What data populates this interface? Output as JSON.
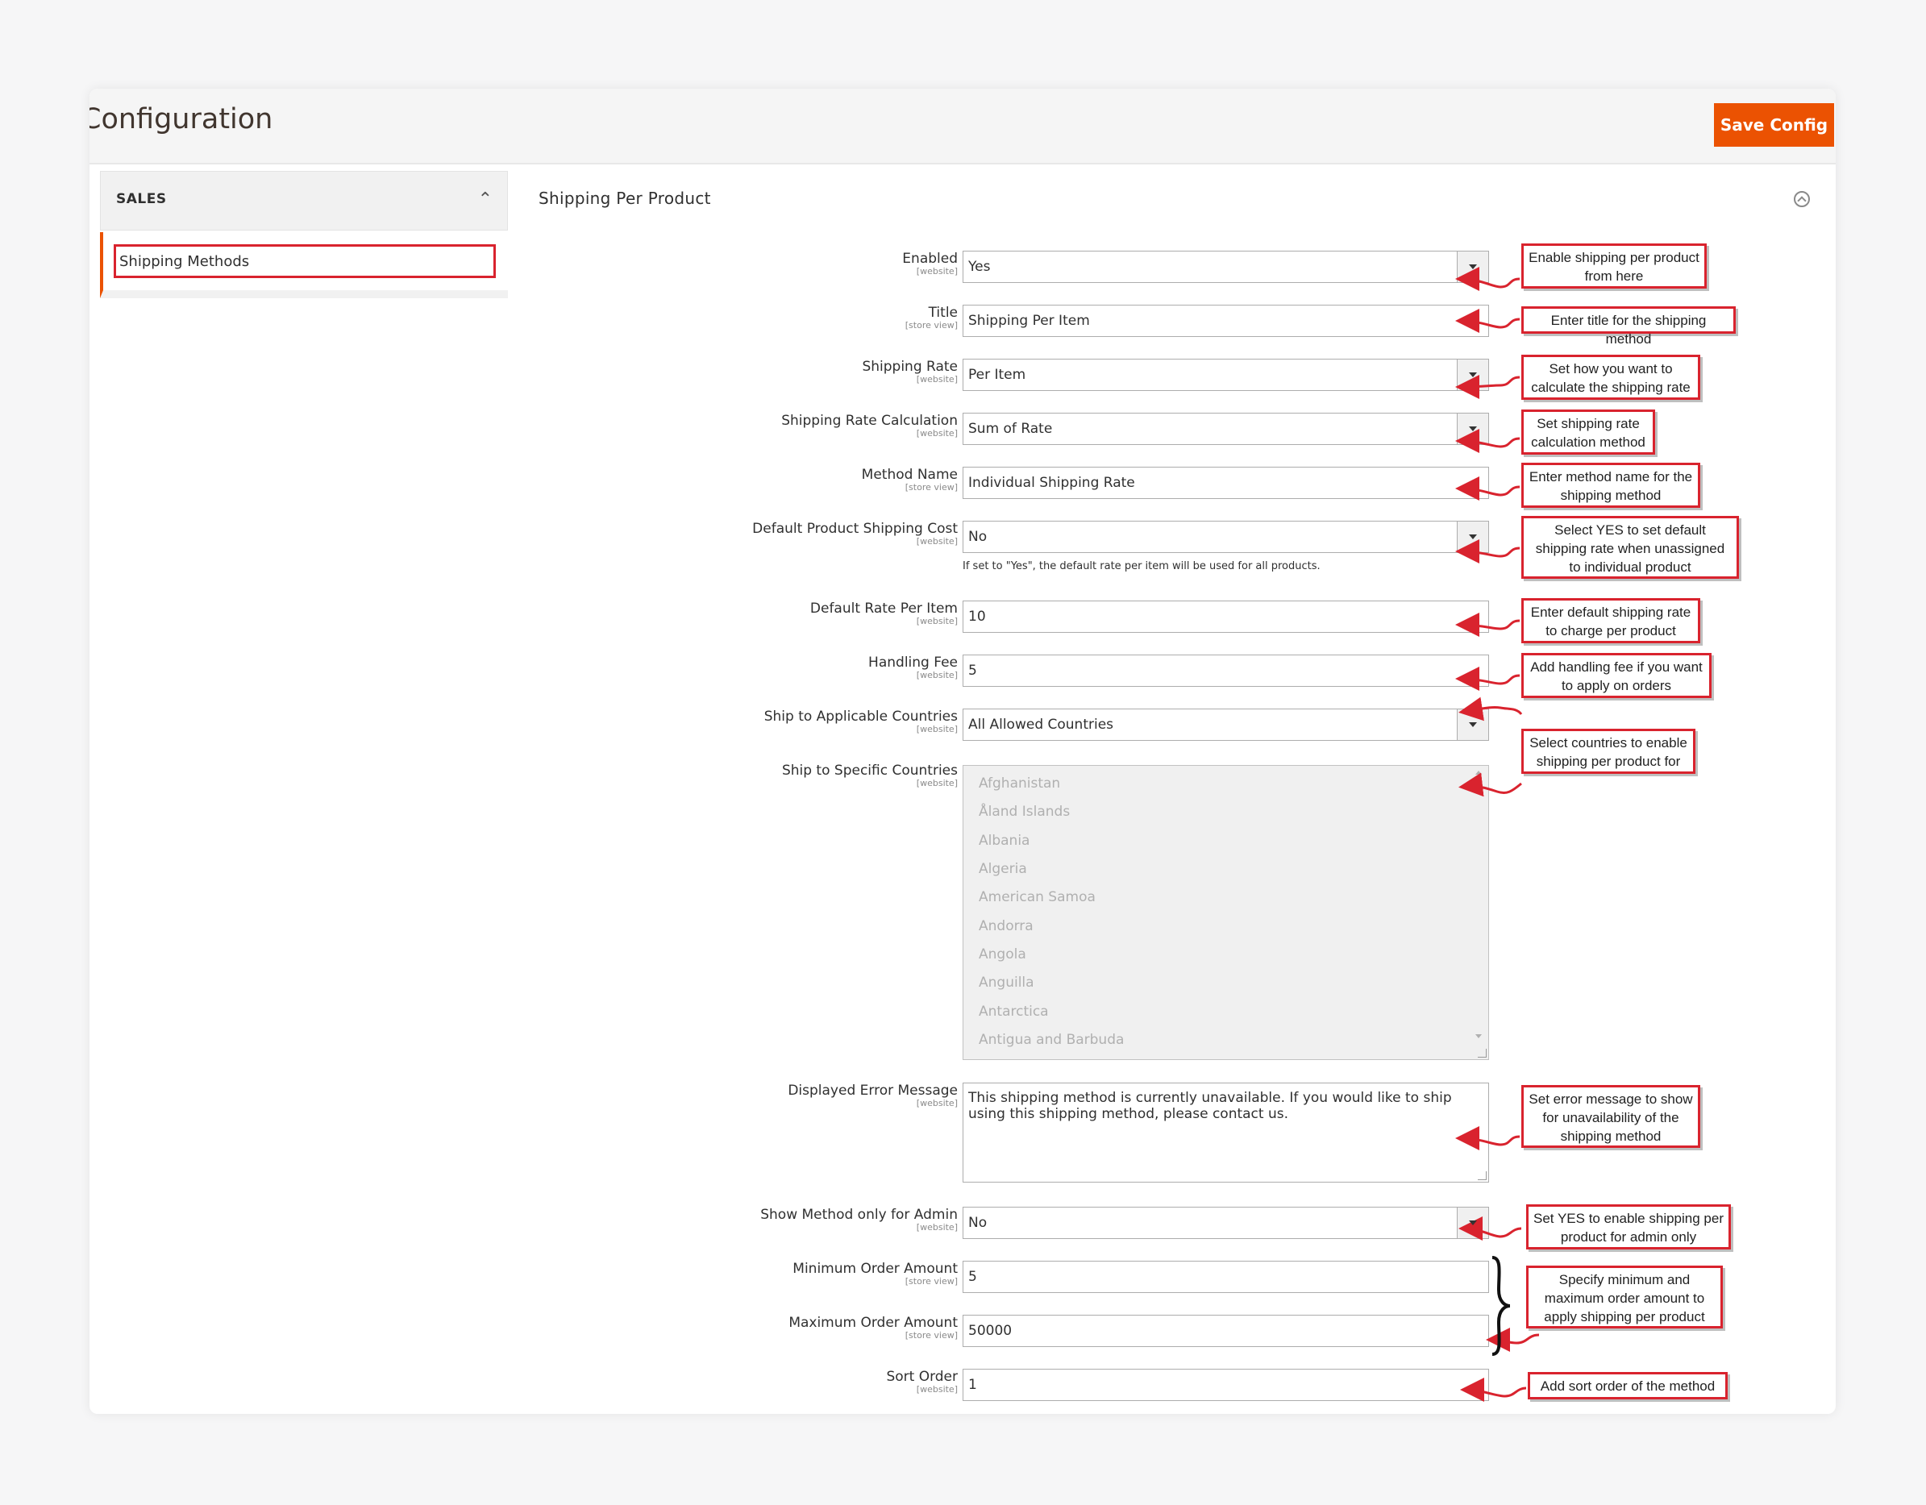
{
  "header": {
    "title": "Configuration",
    "save_label": "Save Config"
  },
  "sidebar": {
    "section_label": "SALES",
    "chevron": "chevron-up-icon",
    "items": [
      {
        "label": "Shipping Methods",
        "active": true
      }
    ]
  },
  "section": {
    "title": "Shipping Per Product",
    "collapse_icon": "collapse-up-circle-icon"
  },
  "fields": [
    {
      "label": "Enabled",
      "scope": "[website]",
      "value": "Yes",
      "kind": "select"
    },
    {
      "label": "Title",
      "scope": "[store view]",
      "value": "Shipping Per Item",
      "kind": "text"
    },
    {
      "label": "Shipping Rate",
      "scope": "[website]",
      "value": "Per Item",
      "kind": "select"
    },
    {
      "label": "Shipping Rate Calculation",
      "scope": "[website]",
      "value": "Sum of Rate",
      "kind": "select"
    },
    {
      "label": "Method Name",
      "scope": "[store view]",
      "value": "Individual Shipping Rate",
      "kind": "text"
    },
    {
      "label": "Default Product Shipping Cost",
      "scope": "[website]",
      "value": "No",
      "kind": "select"
    },
    {
      "label": "Default Rate Per Item",
      "scope": "[website]",
      "value": "10",
      "kind": "text"
    },
    {
      "label": "Handling Fee",
      "scope": "[website]",
      "value": "5",
      "kind": "text"
    },
    {
      "label": "Ship to Applicable Countries",
      "scope": "[website]",
      "value": "All Allowed Countries",
      "kind": "select"
    },
    {
      "label": "Ship to Specific Countries",
      "scope": "[website]",
      "kind": "multiselect"
    },
    {
      "label": "Displayed Error Message",
      "scope": "[website]",
      "value": "This shipping method is currently unavailable. If you would like to ship using this shipping method, please contact us.",
      "kind": "textarea"
    },
    {
      "label": "Show Method only for Admin",
      "scope": "[website]",
      "value": "No",
      "kind": "select"
    },
    {
      "label": "Minimum Order Amount",
      "scope": "[store view]",
      "value": "5",
      "kind": "text"
    },
    {
      "label": "Maximum Order Amount",
      "scope": "[store view]",
      "value": "50000",
      "kind": "text"
    },
    {
      "label": "Sort Order",
      "scope": "[website]",
      "value": "1",
      "kind": "text"
    }
  ],
  "default_cost_note": "If set to \"Yes\", the default rate per item will be used for all products.",
  "countries": [
    "Afghanistan",
    "Åland Islands",
    "Albania",
    "Algeria",
    "American Samoa",
    "Andorra",
    "Angola",
    "Anguilla",
    "Antarctica",
    "Antigua and Barbuda"
  ],
  "callouts": [
    "Enable shipping per product from here",
    "Enter title for the shipping method",
    "Set how you want to calculate the shipping rate",
    "Set shipping rate calculation method",
    "Enter method name for the shipping method",
    "Select YES to set default shipping rate when unassigned to individual product",
    "Enter default shipping rate to charge per product",
    "Add handling fee if you want to apply on orders",
    "Select countries to enable shipping per product for",
    "Set error message to show for unavailability of the shipping method",
    "Set YES to enable shipping per product for admin only",
    "Specify minimum and maximum order amount to apply shipping per product",
    "Add sort order of the method"
  ],
  "colors": {
    "accent": "#eb5202",
    "callout_border": "#d9232e",
    "panel": "#ffffff",
    "page_bg": "#f6f6f7"
  }
}
